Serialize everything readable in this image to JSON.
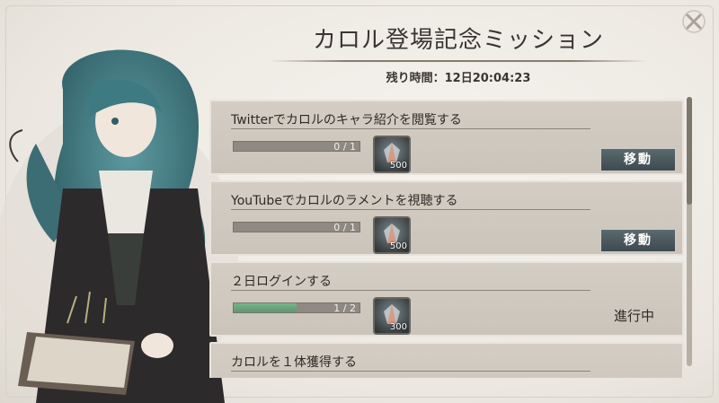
{
  "header": {
    "title": "カロル登場記念ミッション",
    "timer_label": "残り時間：",
    "timer_value": "12日20:04:23"
  },
  "missions": [
    {
      "title": "Twitterでカロルのキャラ紹介を閲覧する",
      "progress_text": "0 / 1",
      "progress_fraction": 0,
      "reward_count": "500",
      "action_label": "移動"
    },
    {
      "title": "YouTubeでカロルのラメントを視聴する",
      "progress_text": "0 / 1",
      "progress_fraction": 0,
      "reward_count": "500",
      "action_label": "移動"
    },
    {
      "title": "２日ログインする",
      "progress_text": "1 / 2",
      "progress_fraction": 0.5,
      "reward_count": "300",
      "status_label": "進行中"
    },
    {
      "title": "カロルを１体獲得する"
    }
  ],
  "colors": {
    "accent_button": "#4a585e",
    "progress_fill": "#6aa47c",
    "card_bg": "#cfc9bf"
  },
  "icons": {
    "close": "close-x-icon",
    "reward": "gem-icon"
  }
}
